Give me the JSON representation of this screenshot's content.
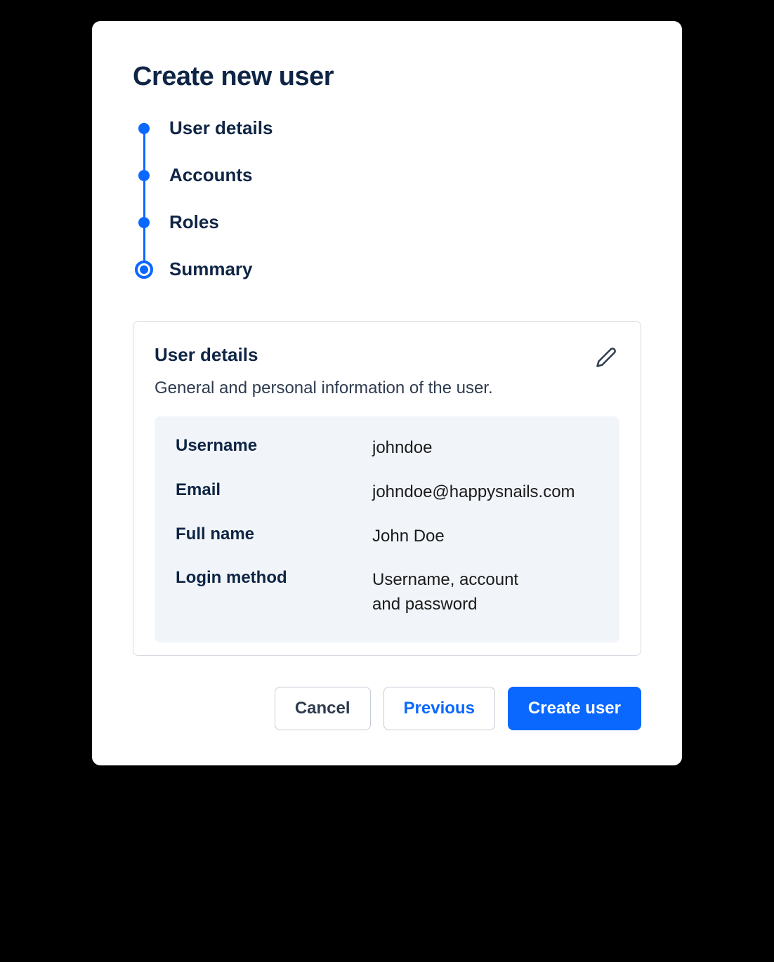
{
  "title": "Create new user",
  "steps": [
    {
      "label": "User details"
    },
    {
      "label": "Accounts"
    },
    {
      "label": "Roles"
    },
    {
      "label": "Summary"
    }
  ],
  "panel": {
    "title": "User details",
    "description": "General and personal information of the user.",
    "rows": [
      {
        "key": "Username",
        "value": "johndoe"
      },
      {
        "key": "Email",
        "value": "johndoe@happysnails.com"
      },
      {
        "key": "Full name",
        "value": "John Doe"
      },
      {
        "key": "Login method",
        "value": "Username, account and password"
      }
    ]
  },
  "footer": {
    "cancel": "Cancel",
    "previous": "Previous",
    "create": "Create user"
  }
}
